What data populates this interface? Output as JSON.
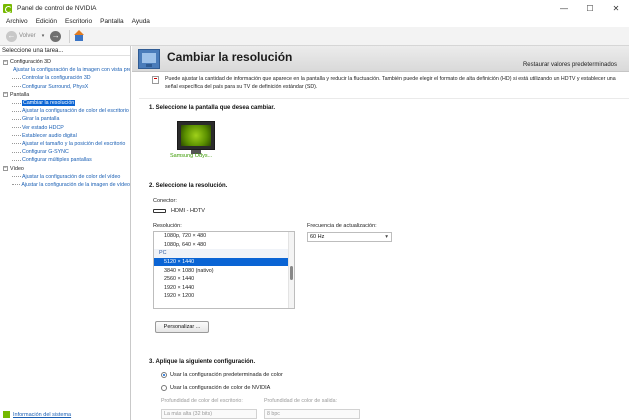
{
  "window": {
    "title": "Panel de control de NVIDIA",
    "minimize": "—",
    "maximize": "☐",
    "close": "✕"
  },
  "menu": [
    "Archivo",
    "Edición",
    "Escritorio",
    "Pantalla",
    "Ayuda"
  ],
  "toolbar": {
    "back_label": "Volver",
    "back_glyph": "←",
    "forward_glyph": "→",
    "dropdown_glyph": "▾"
  },
  "sidebar": {
    "heading": "Seleccione una tarea...",
    "categories": [
      {
        "label": "Configuración 3D",
        "toggle": "−",
        "items": [
          {
            "label": "Ajustar la configuración de la imagen con vista previa",
            "selected": false
          },
          {
            "label": "Controlar la configuración 3D",
            "selected": false
          },
          {
            "label": "Configurar Surround, PhysX",
            "selected": false
          }
        ]
      },
      {
        "label": "Pantalla",
        "toggle": "−",
        "items": [
          {
            "label": "Cambiar la resolución",
            "selected": true
          },
          {
            "label": "Ajustar la configuración de color del escritorio",
            "selected": false
          },
          {
            "label": "Girar la pantalla",
            "selected": false
          },
          {
            "label": "Ver estado HDCP",
            "selected": false
          },
          {
            "label": "Establecer audio digital",
            "selected": false
          },
          {
            "label": "Ajustar el tamaño y la posición del escritorio",
            "selected": false
          },
          {
            "label": "Configurar G-SYNC",
            "selected": false
          },
          {
            "label": "Configurar múltiples pantallas",
            "selected": false
          }
        ]
      },
      {
        "label": "Vídeo",
        "toggle": "−",
        "items": [
          {
            "label": "Ajustar la configuración de color del vídeo",
            "selected": false
          },
          {
            "label": "Ajustar la configuración de la imagen de vídeo",
            "selected": false
          }
        ]
      }
    ],
    "system_info": "Información del sistema"
  },
  "header": {
    "title": "Cambiar la resolución",
    "restore": "Restaurar valores predeterminados"
  },
  "description": "Puede ajustar la cantidad de información que aparece en la pantalla y reducir la fluctuación. También puede elegir el formato de alta definición (HD) si está utilizando un HDTV y establecer una señal específica del país para su TV de definición estándar (SD).",
  "step1": {
    "title": "1. Seleccione la pantalla que desea cambiar.",
    "display_name": "Samsung Odys..."
  },
  "step2": {
    "title": "2. Seleccione la resolución.",
    "connector_label": "Conector:",
    "connector_value": "HDMI - HDTV",
    "resolution_label": "Resolución:",
    "resolutions": [
      {
        "text": "1080p, 720 × 480",
        "kind": "item"
      },
      {
        "text": "1080p, 640 × 480",
        "kind": "item"
      },
      {
        "text": "PC",
        "kind": "group"
      },
      {
        "text": "5120 × 1440",
        "kind": "selected"
      },
      {
        "text": "3840 × 1080 (nativo)",
        "kind": "item"
      },
      {
        "text": "2560 × 1440",
        "kind": "item"
      },
      {
        "text": "1920 × 1440",
        "kind": "item"
      },
      {
        "text": "1920 × 1200",
        "kind": "item"
      }
    ],
    "refresh_label": "Frecuencia de actualización:",
    "refresh_value": "60 Hz",
    "customize_button": "Personalizar ..."
  },
  "step3": {
    "title": "3. Aplique la siguiente configuración.",
    "option_default": "Usar la configuración predeterminada de color",
    "option_nvidia": "Usar la configuración de color de NVIDIA",
    "desktop_depth_label": "Profundidad de color del escritorio:",
    "output_depth_label": "Profundidad de color de salida:",
    "desktop_depth_value": "La más alta (32 bits)",
    "output_depth_value": "8 bpc"
  }
}
